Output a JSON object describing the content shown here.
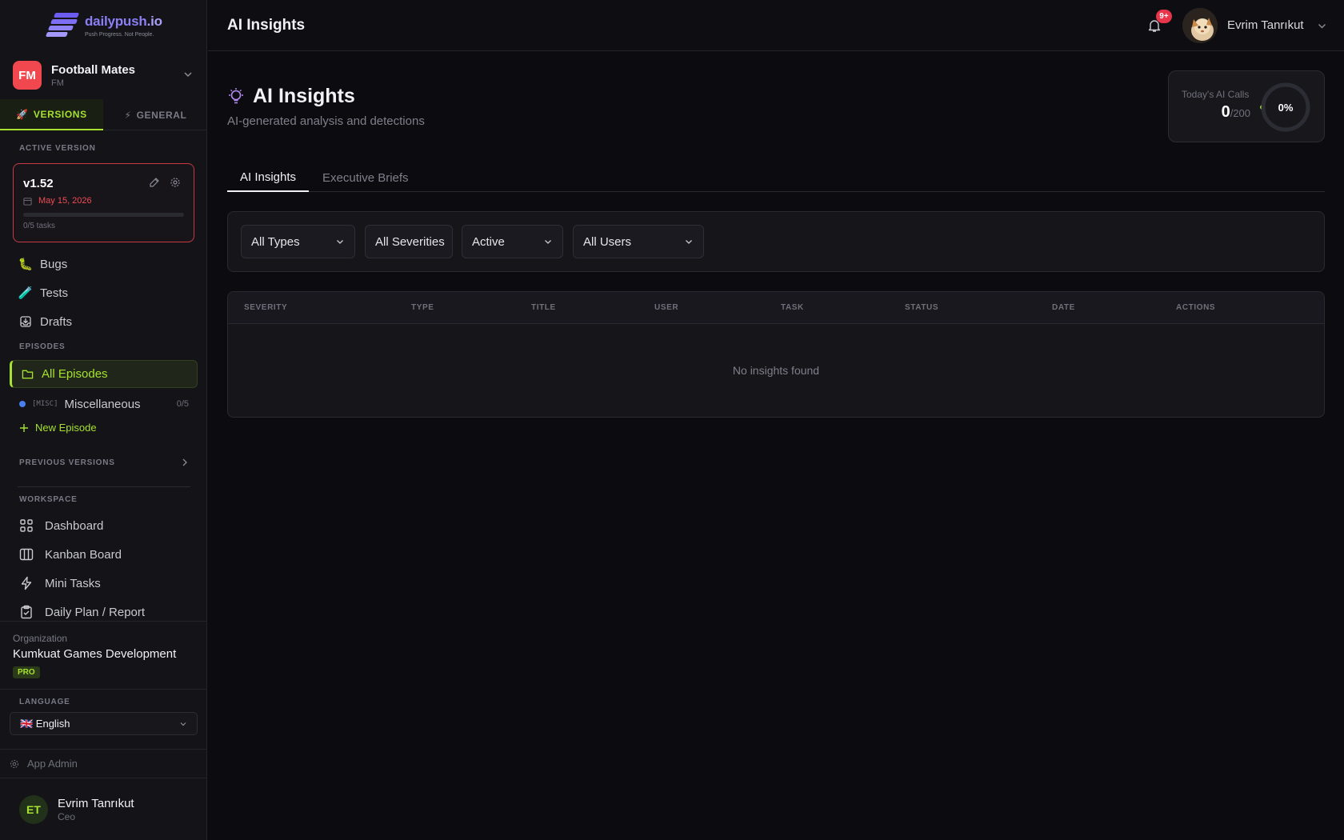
{
  "brand": {
    "name_a": "dailypush",
    "name_b": ".io",
    "tagline": "Push Progress. Not People."
  },
  "project": {
    "initials": "FM",
    "name": "Football Mates",
    "code": "FM"
  },
  "sidebar_tabs": {
    "versions": "VERSIONS",
    "general": "GENERAL"
  },
  "active_version": {
    "section_label": "ACTIVE VERSION",
    "version": "v1.52",
    "date": "May 15, 2026",
    "tasks": "0/5 tasks",
    "progress": 0
  },
  "nav": {
    "bugs": "Bugs",
    "tests": "Tests",
    "drafts": "Drafts"
  },
  "episodes": {
    "section_label": "EPISODES",
    "all": "All Episodes",
    "misc_tag": "[MISC]",
    "misc_name": "Miscellaneous",
    "misc_count": "0/5",
    "new": "New Episode"
  },
  "previous_versions": "PREVIOUS VERSIONS",
  "workspace": {
    "section_label": "WORKSPACE",
    "items": [
      "Dashboard",
      "Kanban Board",
      "Mini Tasks",
      "Daily Plan / Report"
    ]
  },
  "organization": {
    "label": "Organization",
    "name": "Kumkuat Games Development",
    "plan": "PRO"
  },
  "language": {
    "label": "LANGUAGE",
    "value": "🇬🇧 English"
  },
  "app_admin": "App Admin",
  "current_user": {
    "initials": "ET",
    "name": "Evrim Tanrıkut",
    "role": "Ceo"
  },
  "header": {
    "title": "AI Insights",
    "notification_badge": "9+",
    "user_name": "Evrim Tanrıkut"
  },
  "page": {
    "title": "AI Insights",
    "subtitle": "AI-generated analysis and detections"
  },
  "ai_calls": {
    "label": "Today's AI Calls",
    "used": "0",
    "limit": "/200",
    "percent_label": "0%",
    "percent": 0
  },
  "tabs": [
    "AI Insights",
    "Executive Briefs"
  ],
  "filters": [
    "All Types",
    "All Severities",
    "Active",
    "All Users"
  ],
  "table": {
    "columns": [
      "SEVERITY",
      "TYPE",
      "TITLE",
      "USER",
      "TASK",
      "STATUS",
      "DATE",
      "ACTIONS"
    ],
    "empty_text": "No insights found"
  },
  "colors": {
    "accent": "#a6e22e",
    "danger": "#f04b55",
    "brand": "#8b7ff5"
  }
}
